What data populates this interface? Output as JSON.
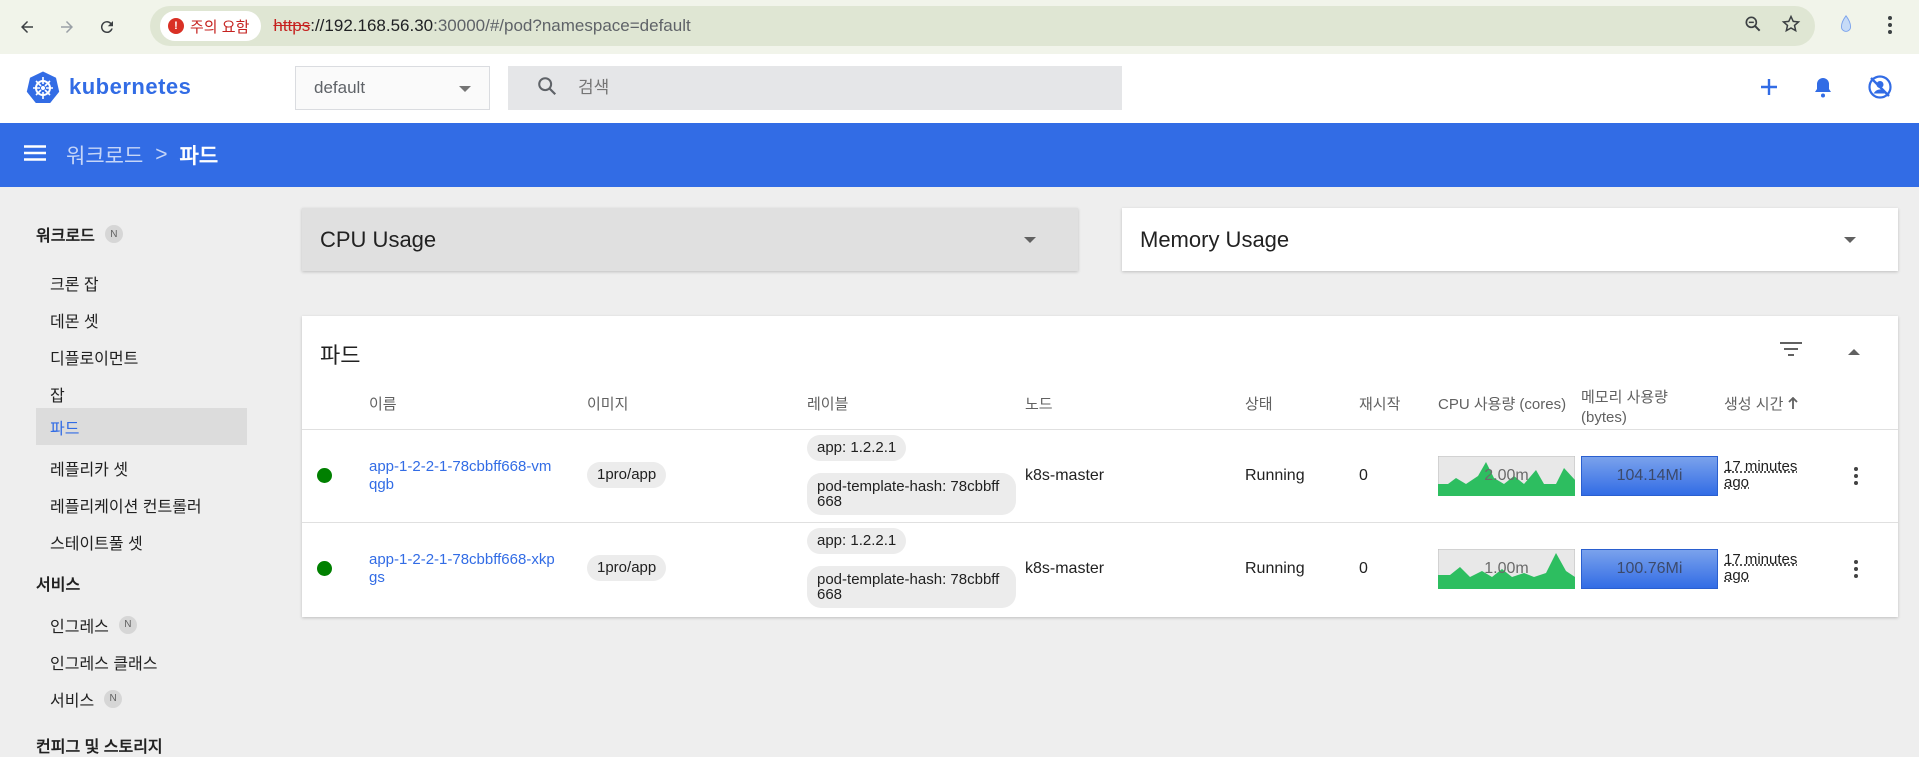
{
  "browser": {
    "security_label": "주의 요함",
    "url_scheme": "https",
    "url_host": "://192.168.56.30",
    "url_rest": ":30000/#/pod?namespace=default"
  },
  "header": {
    "logo_text": "kubernetes",
    "namespace": "default",
    "search_placeholder": "검색"
  },
  "toolbar": {
    "breadcrumb_parent": "워크로드",
    "breadcrumb_sep": ">",
    "breadcrumb_current": "파드"
  },
  "sidebar": {
    "section_workloads": "워크로드",
    "section_workloads_badge": "N",
    "workload_items": [
      "크론 잡",
      "데몬 셋",
      "디플로이먼트",
      "잡",
      "파드",
      "레플리카 셋",
      "레플리케이션 컨트롤러",
      "스테이트풀 셋"
    ],
    "active_item": "파드",
    "section_services": "서비스",
    "service_items": [
      {
        "label": "인그레스",
        "badge": "N"
      },
      {
        "label": "인그레스 클래스",
        "badge": ""
      },
      {
        "label": "서비스",
        "badge": "N"
      }
    ],
    "section_config": "컨피그 및 스토리지"
  },
  "cards": {
    "cpu_title": "CPU Usage",
    "mem_title": "Memory Usage"
  },
  "pods": {
    "title": "파드",
    "columns": [
      "이름",
      "이미지",
      "레이블",
      "노드",
      "상태",
      "재시작",
      "CPU 사용량 (cores)",
      "메모리 사용량 (bytes)",
      "생성 시간"
    ],
    "rows": [
      {
        "name": "app-1-2-2-1-78cbbff668-vmqgb",
        "image": "1pro/app",
        "labels": [
          "app: 1.2.2.1",
          "pod-template-hash: 78cbbff668"
        ],
        "node": "k8s-master",
        "status": "Running",
        "restarts": "0",
        "cpu": "2.00m",
        "memory": "104.14Mi",
        "age": "17 minutes ago",
        "status_color": "#008000"
      },
      {
        "name": "app-1-2-2-1-78cbbff668-xkpgs",
        "image": "1pro/app",
        "labels": [
          "app: 1.2.2.1",
          "pod-template-hash: 78cbbff668"
        ],
        "node": "k8s-master",
        "status": "Running",
        "restarts": "0",
        "cpu": "1.00m",
        "memory": "100.76Mi",
        "age": "17 minutes ago",
        "status_color": "#008000"
      }
    ]
  },
  "colors": {
    "accent": "#326ce5",
    "running": "#008000",
    "sparkline": "#2dbe60"
  }
}
